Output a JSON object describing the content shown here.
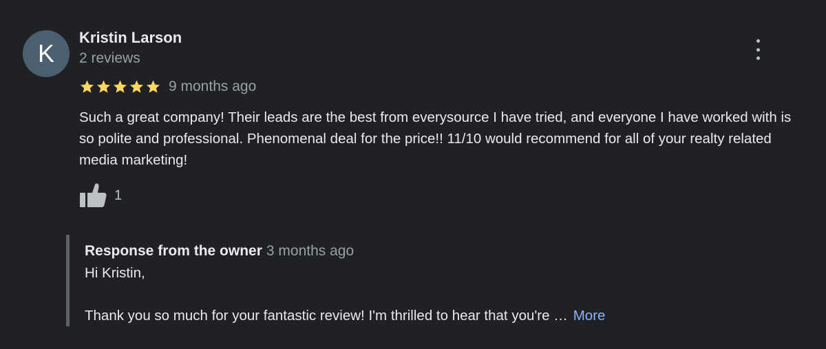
{
  "review": {
    "avatar_initial": "K",
    "avatar_color": "#4a6070",
    "author_name": "Kristin Larson",
    "author_meta": "2 reviews",
    "rating": 5,
    "rating_max": 5,
    "star_color": "#fdd663",
    "date": "9 months ago",
    "text": "Such a great company! Their leads are the best from everysource I have tried, and everyone I have worked with is so polite and professional. Phenomenal deal for the price!! 11/10 would recommend for all of your realty related media marketing!",
    "like_icon": "thumbs-up-icon",
    "like_count": "1",
    "menu_icon": "more-vert-icon"
  },
  "owner_response": {
    "title": "Response from the owner",
    "date": "3 months ago",
    "greeting": "Hi Kristin,",
    "body": "Thank you so much for your fantastic review! I'm thrilled to hear that you're …",
    "more_label": "More",
    "link_color": "#8ab4f8"
  }
}
